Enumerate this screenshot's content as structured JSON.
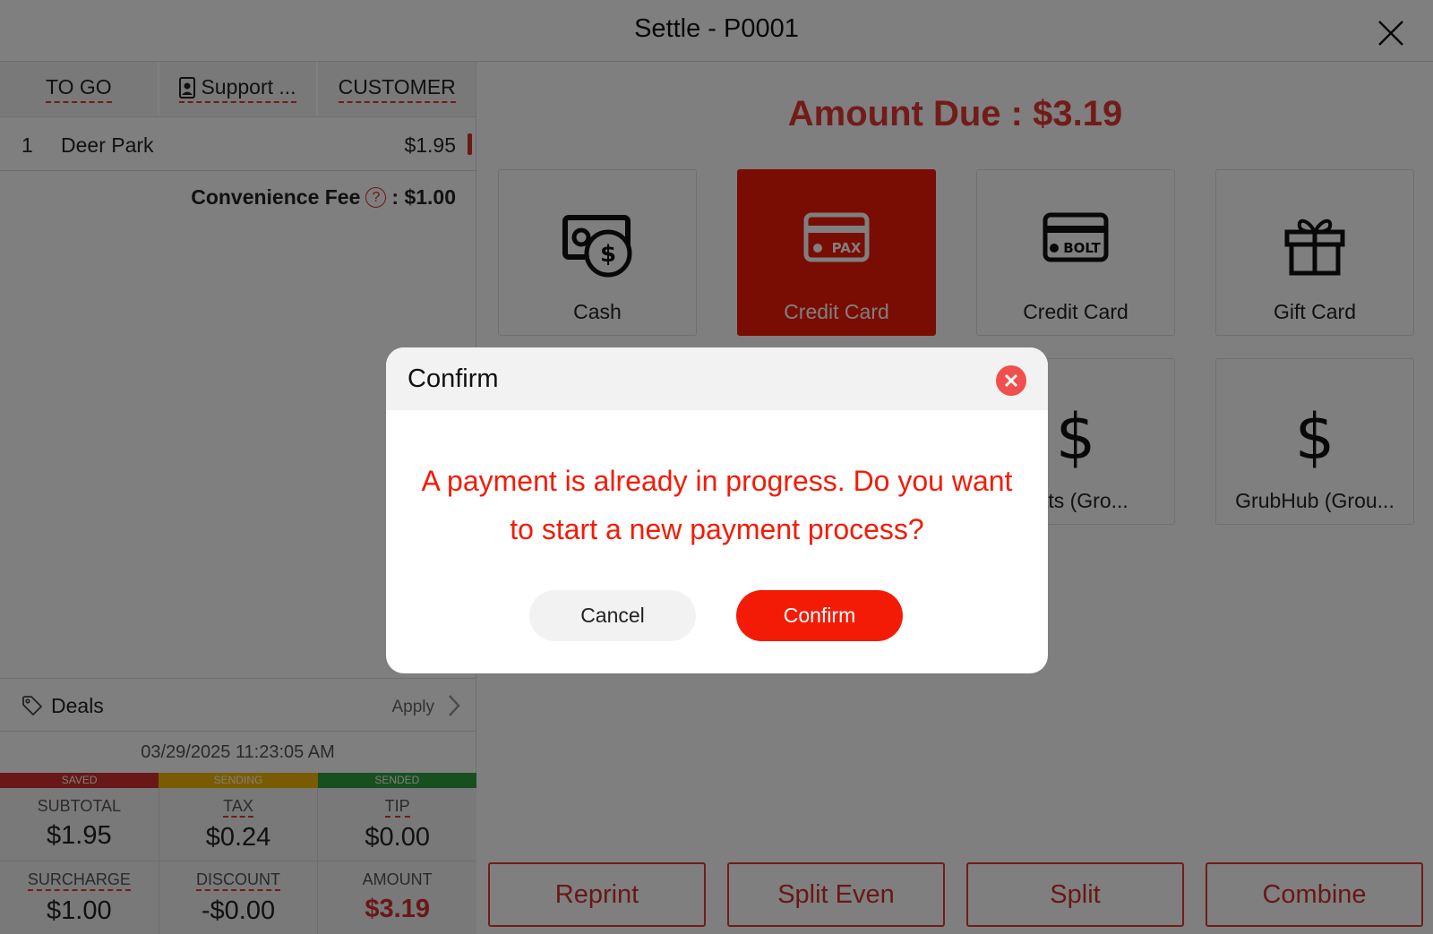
{
  "window": {
    "title": "Settle - P0001"
  },
  "order": {
    "tabs": [
      "TO GO",
      "Support ...",
      "CUSTOMER"
    ],
    "items": [
      {
        "qty": "1",
        "name": "Deer Park",
        "price": "$1.95"
      }
    ],
    "fee_label": "Convenience Fee",
    "fee_value": ": $1.00"
  },
  "deals": {
    "label": "Deals",
    "apply": "Apply"
  },
  "datetime": "03/29/2025 11:23:05 AM",
  "status_bar": [
    {
      "label": "SAVED",
      "color": "#d32f2f"
    },
    {
      "label": "SENDING",
      "color": "#f5b800"
    },
    {
      "label": "SENDED",
      "color": "#2e9e3e"
    }
  ],
  "totals": {
    "subtotal_label": "SUBTOTAL",
    "subtotal": "$1.95",
    "tax_label": "TAX",
    "tax": "$0.24",
    "tip_label": "TIP",
    "tip": "$0.00",
    "surcharge_label": "SURCHARGE",
    "surcharge": "$1.00",
    "discount_label": "DISCOUNT",
    "discount": "-$0.00",
    "amount_label": "AMOUNT",
    "amount": "$3.19"
  },
  "amount_due": "Amount Due : $3.19",
  "payment_methods": [
    {
      "label": "Cash",
      "icon": "cash-icon"
    },
    {
      "label": "Credit Card",
      "icon": "pax-card-icon",
      "badge": "PAX",
      "selected": true
    },
    {
      "label": "Credit Card",
      "icon": "bolt-card-icon",
      "badge": "BOLT"
    },
    {
      "label": "Gift Card",
      "icon": "gift-icon"
    },
    {
      "label": "Eats  (Gro...",
      "icon": "dollar-icon"
    },
    {
      "label": "GrubHub  (Grou...",
      "icon": "dollar-icon"
    }
  ],
  "actions": {
    "reprint": "Reprint",
    "split_even": "Split Even",
    "split": "Split",
    "combine": "Combine"
  },
  "dialog": {
    "title": "Confirm",
    "message": "A payment is already in progress. Do you want to start a new payment process?",
    "cancel": "Cancel",
    "confirm": "Confirm"
  },
  "colors": {
    "accent_red": "#f41b06",
    "text_red": "#e53935",
    "overlay": "rgba(0,0,0,0.5)"
  }
}
